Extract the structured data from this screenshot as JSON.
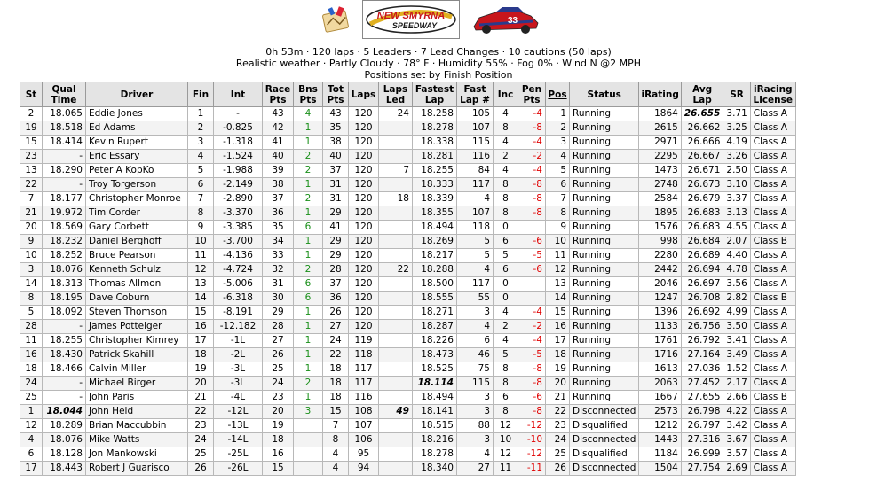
{
  "header": {
    "line1": "0h 53m · 120 laps · 5 Leaders · 7 Lead Changes · 10 cautions (50 laps)",
    "line2": "Realistic weather · Partly Cloudy · 78° F · Humidity 55% · Fog 0% · Wind N @2 MPH",
    "line3": "Positions set by Finish Position",
    "track_logo_text": "NEW SMYRNA SPEEDWAY",
    "car_number": "33"
  },
  "columns": [
    "St",
    "Qual Time",
    "Driver",
    "Fin",
    "Int",
    "Race Pts",
    "Bns Pts",
    "Tot Pts",
    "Laps",
    "Laps Led",
    "Fastest Lap",
    "Fast Lap #",
    "Inc",
    "Pen Pts",
    "Pos",
    "Status",
    "iRating",
    "Avg Lap",
    "SR",
    "iRacing License"
  ],
  "rows": [
    [
      "2",
      "18.065",
      "Eddie Jones",
      "1",
      "-",
      "43",
      "4",
      "43",
      "120",
      "24",
      "18.258",
      "105",
      "4",
      "-4",
      "1",
      "Running",
      "1864",
      "26.655",
      "3.71",
      "Class A"
    ],
    [
      "19",
      "18.518",
      "Ed Adams",
      "2",
      "-0.825",
      "42",
      "1",
      "35",
      "120",
      "",
      "18.278",
      "107",
      "8",
      "-8",
      "2",
      "Running",
      "2615",
      "26.662",
      "3.25",
      "Class A"
    ],
    [
      "15",
      "18.414",
      "Kevin Rupert",
      "3",
      "-1.318",
      "41",
      "1",
      "38",
      "120",
      "",
      "18.338",
      "115",
      "4",
      "-4",
      "3",
      "Running",
      "2971",
      "26.666",
      "4.19",
      "Class A"
    ],
    [
      "23",
      "-",
      "Eric Essary",
      "4",
      "-1.524",
      "40",
      "2",
      "40",
      "120",
      "",
      "18.281",
      "116",
      "2",
      "-2",
      "4",
      "Running",
      "2295",
      "26.667",
      "3.26",
      "Class A"
    ],
    [
      "13",
      "18.290",
      "Peter A KopKo",
      "5",
      "-1.988",
      "39",
      "2",
      "37",
      "120",
      "7",
      "18.255",
      "84",
      "4",
      "-4",
      "5",
      "Running",
      "1473",
      "26.671",
      "2.50",
      "Class A"
    ],
    [
      "22",
      "-",
      "Troy Torgerson",
      "6",
      "-2.149",
      "38",
      "1",
      "31",
      "120",
      "",
      "18.333",
      "117",
      "8",
      "-8",
      "6",
      "Running",
      "2748",
      "26.673",
      "3.10",
      "Class A"
    ],
    [
      "7",
      "18.177",
      "Christopher Monroe",
      "7",
      "-2.890",
      "37",
      "2",
      "31",
      "120",
      "18",
      "18.339",
      "4",
      "8",
      "-8",
      "7",
      "Running",
      "2584",
      "26.679",
      "3.37",
      "Class A"
    ],
    [
      "21",
      "19.972",
      "Tim Corder",
      "8",
      "-3.370",
      "36",
      "1",
      "29",
      "120",
      "",
      "18.355",
      "107",
      "8",
      "-8",
      "8",
      "Running",
      "1895",
      "26.683",
      "3.13",
      "Class A"
    ],
    [
      "20",
      "18.569",
      "Gary Corbett",
      "9",
      "-3.385",
      "35",
      "6",
      "41",
      "120",
      "",
      "18.494",
      "118",
      "0",
      "",
      "9",
      "Running",
      "1576",
      "26.683",
      "4.55",
      "Class A"
    ],
    [
      "9",
      "18.232",
      "Daniel Berghoff",
      "10",
      "-3.700",
      "34",
      "1",
      "29",
      "120",
      "",
      "18.269",
      "5",
      "6",
      "-6",
      "10",
      "Running",
      "998",
      "26.684",
      "2.07",
      "Class B"
    ],
    [
      "10",
      "18.252",
      "Bruce Pearson",
      "11",
      "-4.136",
      "33",
      "1",
      "29",
      "120",
      "",
      "18.217",
      "5",
      "5",
      "-5",
      "11",
      "Running",
      "2280",
      "26.689",
      "4.40",
      "Class A"
    ],
    [
      "3",
      "18.076",
      "Kenneth Schulz",
      "12",
      "-4.724",
      "32",
      "2",
      "28",
      "120",
      "22",
      "18.288",
      "4",
      "6",
      "-6",
      "12",
      "Running",
      "2442",
      "26.694",
      "4.78",
      "Class A"
    ],
    [
      "14",
      "18.313",
      "Thomas Allmon",
      "13",
      "-5.006",
      "31",
      "6",
      "37",
      "120",
      "",
      "18.500",
      "117",
      "0",
      "",
      "13",
      "Running",
      "2046",
      "26.697",
      "3.56",
      "Class A"
    ],
    [
      "8",
      "18.195",
      "Dave Coburn",
      "14",
      "-6.318",
      "30",
      "6",
      "36",
      "120",
      "",
      "18.555",
      "55",
      "0",
      "",
      "14",
      "Running",
      "1247",
      "26.708",
      "2.82",
      "Class B"
    ],
    [
      "5",
      "18.092",
      "Steven Thomson",
      "15",
      "-8.191",
      "29",
      "1",
      "26",
      "120",
      "",
      "18.271",
      "3",
      "4",
      "-4",
      "15",
      "Running",
      "1396",
      "26.692",
      "4.99",
      "Class A"
    ],
    [
      "28",
      "-",
      "James Potteiger",
      "16",
      "-12.182",
      "28",
      "1",
      "27",
      "120",
      "",
      "18.287",
      "4",
      "2",
      "-2",
      "16",
      "Running",
      "1133",
      "26.756",
      "3.50",
      "Class A"
    ],
    [
      "11",
      "18.255",
      "Christopher Kimrey",
      "17",
      "-1L",
      "27",
      "1",
      "24",
      "119",
      "",
      "18.226",
      "6",
      "4",
      "-4",
      "17",
      "Running",
      "1761",
      "26.792",
      "3.41",
      "Class A"
    ],
    [
      "16",
      "18.430",
      "Patrick Skahill",
      "18",
      "-2L",
      "26",
      "1",
      "22",
      "118",
      "",
      "18.473",
      "46",
      "5",
      "-5",
      "18",
      "Running",
      "1716",
      "27.164",
      "3.49",
      "Class A"
    ],
    [
      "18",
      "18.466",
      "Calvin Miller",
      "19",
      "-3L",
      "25",
      "1",
      "18",
      "117",
      "",
      "18.525",
      "75",
      "8",
      "-8",
      "19",
      "Running",
      "1613",
      "27.036",
      "1.52",
      "Class A"
    ],
    [
      "24",
      "-",
      "Michael Birger",
      "20",
      "-3L",
      "24",
      "2",
      "18",
      "117",
      "",
      "18.114",
      "115",
      "8",
      "-8",
      "20",
      "Running",
      "2063",
      "27.452",
      "2.17",
      "Class A"
    ],
    [
      "25",
      "-",
      "John Paris",
      "21",
      "-4L",
      "23",
      "1",
      "18",
      "116",
      "",
      "18.494",
      "3",
      "6",
      "-6",
      "21",
      "Running",
      "1667",
      "27.655",
      "2.66",
      "Class B"
    ],
    [
      "1",
      "18.044",
      "John Held",
      "22",
      "-12L",
      "20",
      "3",
      "15",
      "108",
      "49",
      "18.141",
      "3",
      "8",
      "-8",
      "22",
      "Disconnected",
      "2573",
      "26.798",
      "4.22",
      "Class A"
    ],
    [
      "12",
      "18.289",
      "Brian Maccubbin",
      "23",
      "-13L",
      "19",
      "",
      "7",
      "107",
      "",
      "18.515",
      "88",
      "12",
      "-12",
      "23",
      "Disqualified",
      "1212",
      "26.797",
      "3.42",
      "Class A"
    ],
    [
      "4",
      "18.076",
      "Mike Watts",
      "24",
      "-14L",
      "18",
      "",
      "8",
      "106",
      "",
      "18.216",
      "3",
      "10",
      "-10",
      "24",
      "Disconnected",
      "1443",
      "27.316",
      "3.67",
      "Class A"
    ],
    [
      "6",
      "18.128",
      "Jon Mankowski",
      "25",
      "-25L",
      "16",
      "",
      "4",
      "95",
      "",
      "18.278",
      "4",
      "12",
      "-12",
      "25",
      "Disqualified",
      "1184",
      "26.999",
      "3.57",
      "Class A"
    ],
    [
      "17",
      "18.443",
      "Robert J Guarisco",
      "26",
      "-26L",
      "15",
      "",
      "4",
      "94",
      "",
      "18.340",
      "27",
      "11",
      "-11",
      "26",
      "Disconnected",
      "1504",
      "27.754",
      "2.69",
      "Class A"
    ]
  ],
  "highlights": [
    {
      "row": 0,
      "col": 17
    },
    {
      "row": 19,
      "col": 10
    },
    {
      "row": 21,
      "col": 1
    },
    {
      "row": 21,
      "col": 9
    }
  ],
  "colors": {
    "bonus": "#1a8f1a",
    "penalty": "#e00000",
    "header_bg": "#e4e4e4"
  }
}
